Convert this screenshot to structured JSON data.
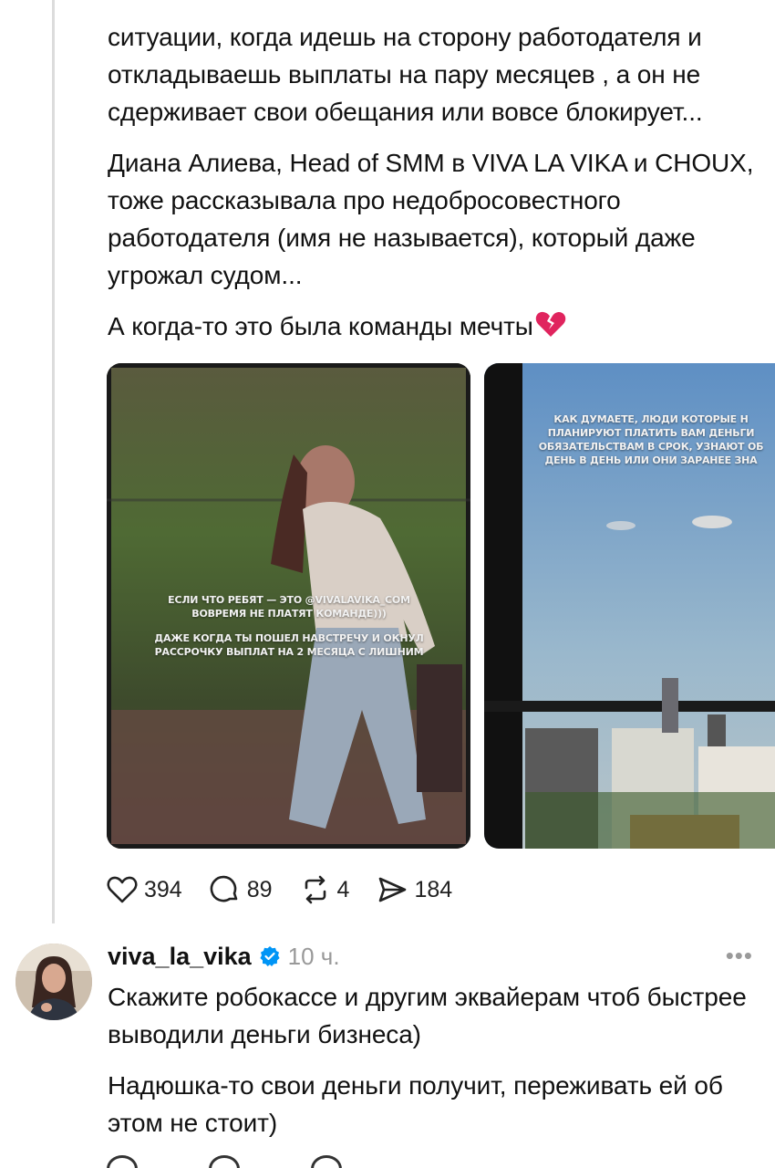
{
  "post": {
    "paragraphs": [
      "ситуации, когда идешь на сторону работодателя и откладываешь выплаты на пару месяцев , а он не сдерживает свои обещания или вовсе блокирует...",
      "Диана Алиева,  Head of SMM в VIVA LA VIKA и CHOUX, тоже рассказывала про недобросовестного работодателя (имя не называется), который даже угрожал судом...",
      "А когда-то это была команды мечты"
    ],
    "emoji": "broken-heart-icon",
    "media": [
      {
        "lines": [
          "ЕСЛИ ЧТО РЕБЯТ — ЭТО @VIVALAVIKA_COM",
          "ВОВРЕМЯ НЕ ПЛАТЯТ КОМАНДЕ)))",
          "",
          "ДАЖЕ КОГДА ТЫ ПОШЕЛ НАВСТРЕЧУ И ОКНУЛ",
          "РАССРОЧКУ ВЫПЛАТ НА 2 МЕСЯЦА С ЛИШНИМ"
        ]
      },
      {
        "lines": [
          "КАК ДУМАЕТЕ, ЛЮДИ КОТОРЫЕ Н",
          "ПЛАНИРУЮТ ПЛАТИТЬ ВАМ ДЕНЬГИ",
          "ОБЯЗАТЕЛЬСТВАМ В СРОК, УЗНАЮТ ОБ",
          "ДЕНЬ В ДЕНЬ ИЛИ ОНИ ЗАРАНЕЕ ЗНА"
        ]
      }
    ],
    "actions": {
      "likes": "394",
      "comments": "89",
      "reposts": "4",
      "shares": "184"
    }
  },
  "reply": {
    "username": "viva_la_vika",
    "time": "10 ч.",
    "more": "•••",
    "paragraphs": [
      "Скажите робокассе и другим эквайерам чтоб быстрее выводили деньги бизнеса)",
      "Надюшка-то свои деньги получит, переживать ей об этом не стоит)"
    ]
  },
  "colors": {
    "verified": "#0095f6",
    "text": "#111111",
    "muted": "#999999",
    "broken_heart": "#e0245e"
  }
}
